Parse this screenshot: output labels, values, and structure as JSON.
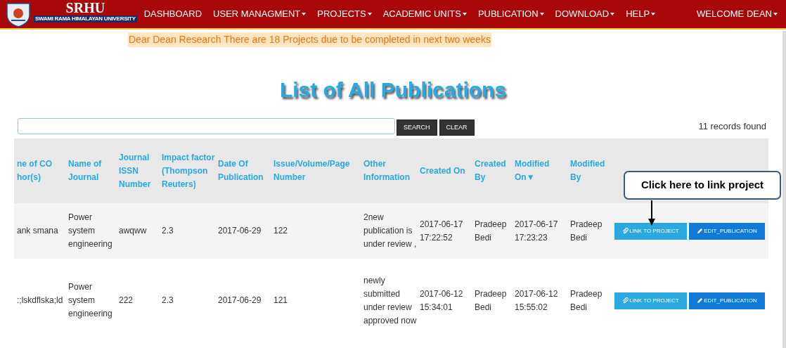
{
  "navbar": {
    "logo": {
      "title": "SRHU",
      "subtitle": "SWAMI RAMA HIMALAYAN UNIVERSITY"
    },
    "menu": [
      {
        "label": "DASHBOARD",
        "dropdown": false
      },
      {
        "label": "USER MANAGMENT",
        "dropdown": true
      },
      {
        "label": "PROJECTS",
        "dropdown": true
      },
      {
        "label": "ACADEMIC UNITS",
        "dropdown": true
      },
      {
        "label": "PUBLICATION",
        "dropdown": true
      },
      {
        "label": "DOWNLOAD",
        "dropdown": true
      },
      {
        "label": "HELP",
        "dropdown": true
      }
    ],
    "user_menu": {
      "label": "WELCOME DEAN",
      "dropdown": true
    }
  },
  "alert": "Dear Dean Research There are 18 Projects due to be completed in next two weeks",
  "page_title": "List of All Publications",
  "search": {
    "buttons": [
      "SEARCH",
      "CLEAR"
    ],
    "records": "11 records found"
  },
  "table": {
    "columns": [
      "ne of CO hor(s)",
      "Name of Journal",
      "Journal ISSN Number",
      "Impact factor (Thompson Reuters)",
      "Date Of Publication",
      "Issue/Volume/Page Number",
      "Other Information",
      "Created On",
      "Created By",
      "Modified On▼",
      "Modified By"
    ],
    "rows": [
      {
        "cells": [
          "ank smana",
          "Power system engineering",
          "awqww",
          "2.3",
          "2017-06-29",
          "122",
          "2new publication is under review ,",
          "2017-06-17 17:22:52",
          "Pradeep Bedi",
          "2017-06-17 17:23:23",
          "Pradeep Bedi"
        ],
        "actions": [
          "LINK TO PROJECT",
          "EDIT_PUBLICATION"
        ]
      },
      {
        "cells": [
          ":;lskdflska;ld",
          "Power system engineering",
          "222",
          "2.3",
          "2017-06-29",
          "121",
          "newly submitted under review approved now",
          "2017-06-12 15:34:01",
          "Pradeep Bedi",
          "2017-06-12 15:55:02",
          "Pradeep Bedi"
        ],
        "actions": [
          "LINK TO PROJECT",
          "EDIT_PUBLICATION"
        ]
      }
    ]
  },
  "callout": "Click here to link project"
}
